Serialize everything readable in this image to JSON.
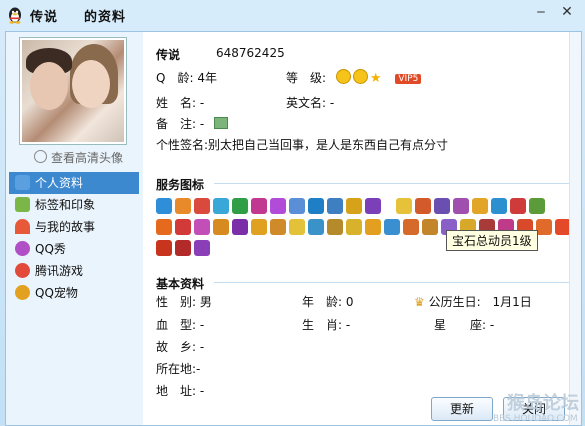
{
  "window": {
    "title_name": "传说",
    "title_suffix": "的资料",
    "minimize": "‒",
    "close": "✕"
  },
  "sidebar": {
    "view_hd_avatar": "查看高清头像",
    "items": [
      {
        "label": "个人资料",
        "icon": "profile-card-icon",
        "color": "#5aa0e0",
        "active": true
      },
      {
        "label": "标签和印象",
        "icon": "tag-icon",
        "color": "#7ab648"
      },
      {
        "label": "与我的故事",
        "icon": "rainbow-icon",
        "color": "#e8593a"
      },
      {
        "label": "QQ秀",
        "icon": "qqshow-icon",
        "color": "#b04fc6"
      },
      {
        "label": "腾讯游戏",
        "icon": "game-icon",
        "color": "#e24b3b"
      },
      {
        "label": "QQ宠物",
        "icon": "pet-icon",
        "color": "#e2a11e"
      }
    ]
  },
  "profile": {
    "nickname": "传说",
    "qq_number": "648762425",
    "qq_age_label": "Q　龄:",
    "qq_age_value": "4年",
    "level_label": "等　级:",
    "vip_badge": "VIP5",
    "name_label": "姓　名:",
    "name_value": "-",
    "english_name_label": "英文名:",
    "english_name_value": "-",
    "note_label": "备　注:",
    "note_value": "-",
    "signature_label": "个性签名:",
    "signature_value": "别太把自己当回事，是人是东西自己有点分寸"
  },
  "service_icons": {
    "title": "服务图标",
    "tooltip": "宝石总动员1级",
    "row1": [
      "#2e8fd8",
      "#e98a2a",
      "#d94a3c",
      "#3aa7d9",
      "#2f9e46",
      "#c0388f",
      "#b24bd8",
      "#5a8fd8",
      "#1e7fc6",
      "#3d7fc0",
      "#d6a21a",
      "#7b3fb8",
      "#e5c23a",
      "#d35a2a",
      "#6a4fb0",
      "#a04faf",
      "#e3a528",
      "#2b8fd0",
      "#cf3b3b",
      "#5c9b3a"
    ],
    "row2": [
      "#e66a1e",
      "#d13a38",
      "#c24fb8",
      "#d68a20",
      "#7a2fa8",
      "#e0a020",
      "#cf8a2a",
      "#e3c23a",
      "#3a93c8",
      "#b58a2a",
      "#d9b22b",
      "#e3a020",
      "#3a8fd0",
      "#d66a2a",
      "#c2852a",
      "#8a5fc8",
      "#d8a82a",
      "#a93a3a",
      "#c03a8a",
      "#d84a2a",
      "#e06a2a",
      "#e44a2a"
    ],
    "row3": [
      "#c8341e",
      "#b22a2a",
      "#8a3fb8"
    ]
  },
  "basic": {
    "title": "基本资料",
    "gender_label": "性　别:",
    "gender_value": "男",
    "age_label": "年　龄:",
    "age_value": "0",
    "birthday_label": "公历生日:",
    "birthday_value": "1月1日",
    "blood_label": "血　型:",
    "blood_value": "-",
    "zodiac_label": "生　肖:",
    "zodiac_value": "-",
    "constellation_label": "星　　座:",
    "constellation_value": "-",
    "hometown_label": "故　乡:",
    "hometown_value": "-",
    "location_label": "所在地:",
    "location_value": "-",
    "address_label": "地　址:",
    "address_value": "-"
  },
  "footer": {
    "refresh": "更新",
    "close": "关闭"
  },
  "watermark": {
    "text": "猴岛论坛",
    "url": "BBS.HOUDAO.COM"
  }
}
